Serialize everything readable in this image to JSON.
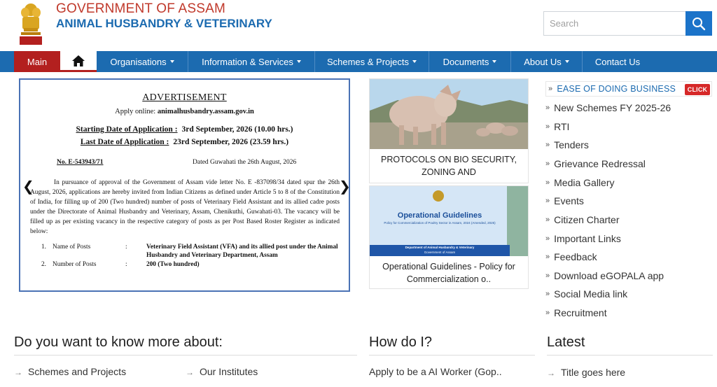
{
  "header": {
    "title_line1": "GOVERNMENT OF ASSAM",
    "title_line2": "ANIMAL HUSBANDRY & VETERINARY",
    "search_placeholder": "Search"
  },
  "nav": {
    "main": "Main",
    "items": [
      "Organisations",
      "Information & Services",
      "Schemes & Projects",
      "Documents",
      "About Us",
      "Contact Us"
    ]
  },
  "advertisement": {
    "heading": "ADVERTISEMENT",
    "apply_label": "Apply online:",
    "apply_url": "animalhusbandry.assam.gov.in",
    "start_label": "Starting Date of Application :",
    "start_value": "3rd September, 2026 (10.00 hrs.)",
    "last_label": "Last Date of Application :",
    "last_value": "23rd September, 2026 (23.59 hrs.)",
    "ref_no": "No. E-543943/71",
    "dated": "Dated Guwahati the 26th August, 2026",
    "body": "In pursuance of approval of the Government of Assam vide letter No. E -837098/34 dated spur the 26th August, 2026, applications are hereby invited from Indian Citizens as defined under Article 5 to 8 of the Constitution of India, for filling up of 200 (Two hundred) number of posts of Veterinary Field Assistant and its allied cadre posts under the Directorate of Animal Husbandry and Veterinary, Assam, Chenikuthi, Guwahati-03. The vacancy will be filled up as per existing vacancy in the respective category of posts as per Post Based Roster Register as indicated below:",
    "list": [
      {
        "num": "1.",
        "name": "Name of Posts",
        "value": "Veterinary Field Assistant (VFA) and its allied post under the Animal Husbandry and Veterinary Department, Assam"
      },
      {
        "num": "2.",
        "name": "Number of Posts",
        "value": "200 (Two hundred)"
      }
    ],
    "prev_arrow": "❮",
    "next_arrow": "❯"
  },
  "tiles": [
    {
      "caption": "PROTOCOLS ON BIO SECURITY, ZONING AND"
    },
    {
      "caption": "Operational Guidelines - Policy for Commercialization o..",
      "img_title": "Operational Guidelines",
      "img_sub": "Policy for Commercialization of Poultry Sector in Assam, 2024 (Amended, 2025)",
      "img_dept": "Department of Animal Husbandry & Veterinary",
      "img_gov": "Government of Assam"
    }
  ],
  "sidebar": {
    "first": "EASE OF DOING BUSINESS",
    "click_badge": "CLICK",
    "items": [
      "New Schemes FY 2025-26",
      "RTI",
      "Tenders",
      "Grievance Redressal",
      "Media Gallery",
      "Events",
      "Citizen Charter",
      "Important Links",
      "Feedback",
      "Download eGOPALA app",
      "Social Media link",
      "Recruitment"
    ]
  },
  "sections": {
    "know_more": {
      "title": "Do you want to know more about:",
      "links": [
        "Schemes and Projects",
        "Our Institutes"
      ]
    },
    "how_do_i": {
      "title": "How do I?",
      "links": [
        "Apply to be a AI Worker (Gop.."
      ]
    },
    "latest": {
      "title": "Latest",
      "links": [
        "Title goes here"
      ]
    }
  },
  "colors": {
    "brand_blue": "#1c6bb0",
    "brand_red": "#b3201f",
    "title_red": "#c0392b"
  }
}
